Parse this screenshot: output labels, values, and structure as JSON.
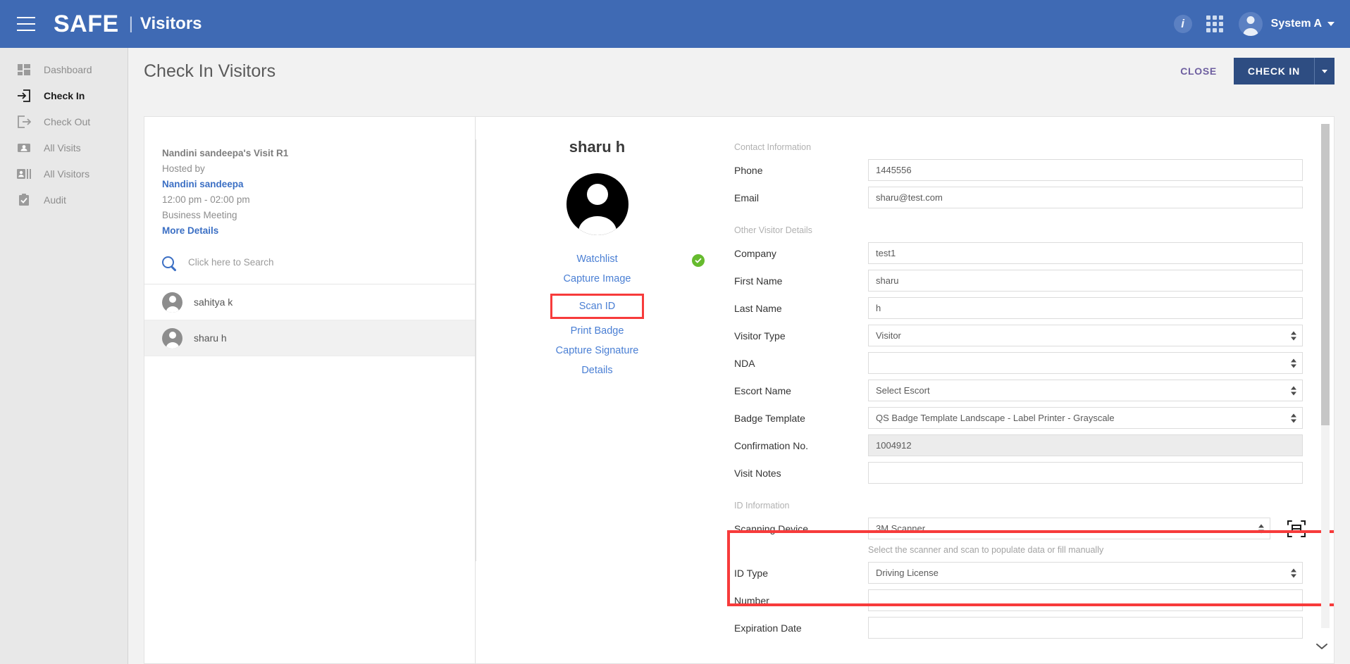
{
  "topbar": {
    "brand": "SAFE",
    "separator": "|",
    "module": "Visitors",
    "user_name": "System A"
  },
  "sidebar": {
    "items": [
      {
        "label": "Dashboard",
        "icon": "dashboard-icon",
        "active": false
      },
      {
        "label": "Check In",
        "icon": "check-in-icon",
        "active": true
      },
      {
        "label": "Check Out",
        "icon": "check-out-icon",
        "active": false
      },
      {
        "label": "All Visits",
        "icon": "visits-icon",
        "active": false
      },
      {
        "label": "All Visitors",
        "icon": "visitors-icon",
        "active": false
      },
      {
        "label": "Audit",
        "icon": "audit-icon",
        "active": false
      }
    ]
  },
  "page": {
    "title": "Check In Visitors",
    "close_label": "CLOSE",
    "checkin_label": "CHECK IN"
  },
  "visit": {
    "title": "Nandini sandeepa's Visit R1",
    "hosted_by_label": "Hosted by",
    "host_name": "Nandini sandeepa",
    "time_range": "12:00 pm - 02:00 pm",
    "purpose": "Business Meeting",
    "more_details": "More Details"
  },
  "search": {
    "placeholder": "Click here to Search",
    "value": ""
  },
  "visitor_list": [
    {
      "name": "sahitya k",
      "selected": false
    },
    {
      "name": "sharu h",
      "selected": true
    }
  ],
  "selected_visitor": {
    "name": "sharu h",
    "actions": [
      {
        "label": "Watchlist",
        "highlighted": false,
        "status": "ok"
      },
      {
        "label": "Capture Image",
        "highlighted": false
      },
      {
        "label": "Scan ID",
        "highlighted": true
      },
      {
        "label": "Print Badge",
        "highlighted": false
      },
      {
        "label": "Capture Signature",
        "highlighted": false
      },
      {
        "label": "Details",
        "highlighted": false
      }
    ]
  },
  "form": {
    "contact_section": "Contact Information",
    "phone_label": "Phone",
    "phone_value": "1445556",
    "email_label": "Email",
    "email_value": "sharu@test.com",
    "other_section": "Other Visitor Details",
    "company_label": "Company",
    "company_value": "test1",
    "first_name_label": "First Name",
    "first_name_value": "sharu",
    "last_name_label": "Last Name",
    "last_name_value": "h",
    "visitor_type_label": "Visitor Type",
    "visitor_type_value": "Visitor",
    "nda_label": "NDA",
    "nda_value": "",
    "escort_label": "Escort Name",
    "escort_value": "Select Escort",
    "badge_template_label": "Badge Template",
    "badge_template_value": "QS Badge Template Landscape - Label Printer - Grayscale",
    "confirmation_label": "Confirmation No.",
    "confirmation_value": "1004912",
    "visit_notes_label": "Visit Notes",
    "visit_notes_value": "",
    "id_section": "ID Information",
    "scanning_device_label": "Scanning Device",
    "scanning_device_value": "3M Scanner",
    "scanner_helper": "Select the scanner and scan to populate data or fill manually",
    "id_type_label": "ID Type",
    "id_type_value": "Driving License",
    "number_label": "Number",
    "number_value": "",
    "expiration_label": "Expiration Date",
    "expiration_value": ""
  },
  "colors": {
    "brand_blue": "#3f6ab4",
    "primary_button": "#2e4d82",
    "link_blue": "#4a7fd4",
    "highlight_red": "#f73b3b",
    "status_green": "#66bb2e",
    "close_purple": "#6e5fa0"
  }
}
